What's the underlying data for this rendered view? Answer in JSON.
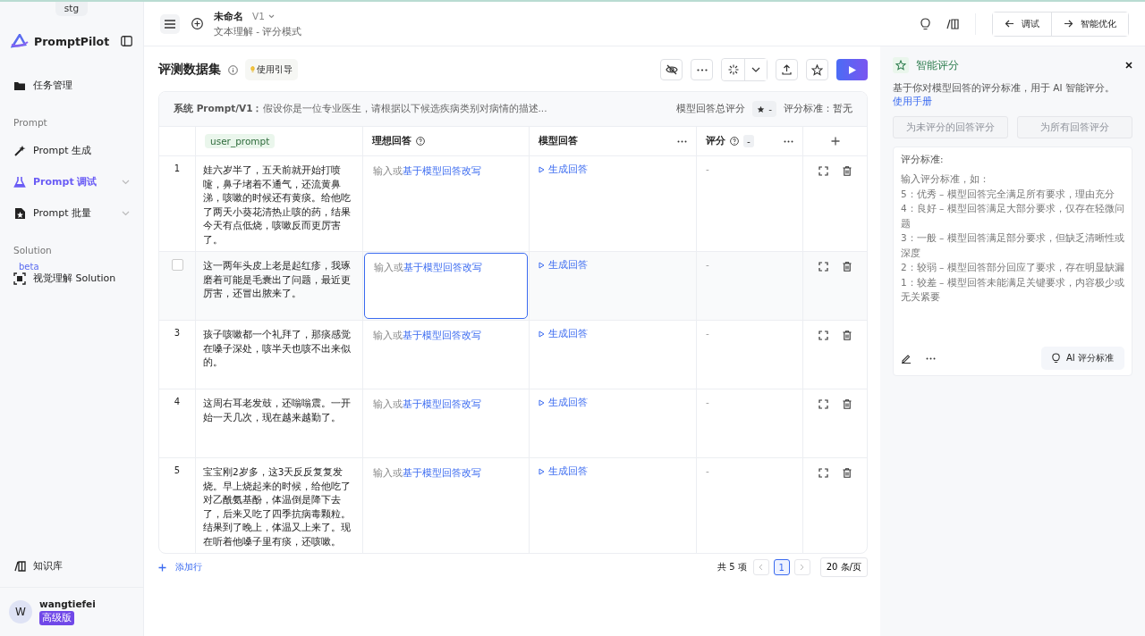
{
  "sidebar": {
    "env": "stg",
    "brand": "PromptPilot",
    "items": [
      {
        "kind": "item",
        "label": "任务管理",
        "selected": false,
        "expandable": false
      },
      {
        "kind": "section",
        "label": "Prompt"
      },
      {
        "kind": "item",
        "label": "Prompt 生成",
        "selected": false,
        "expandable": false
      },
      {
        "kind": "item",
        "label": "Prompt 调试",
        "selected": true,
        "expandable": true
      },
      {
        "kind": "item",
        "label": "Prompt 批量",
        "selected": false,
        "expandable": true
      },
      {
        "kind": "section",
        "label": "Solution"
      },
      {
        "kind": "item",
        "label": "视觉理解 Solution",
        "badge": "beta",
        "selected": false,
        "expandable": false
      }
    ],
    "bottom_item": "知识库",
    "user": {
      "initial": "W",
      "name": "wangtiefei",
      "plan": "高级版"
    }
  },
  "topbar": {
    "title": "未命名",
    "version": "V1",
    "subtitle": "文本理解 - 评分模式",
    "buttons": [
      {
        "kind": "back",
        "label": "调试"
      },
      {
        "kind": "forward",
        "label": "智能优化"
      }
    ]
  },
  "dataset": {
    "title": "评测数据集",
    "guide": "使用引导",
    "system_label": "系统 Prompt/V1：",
    "system_prompt": "假设你是一位专业医生，请根据以下候选疾病类别对病情的描述...",
    "total_score_label": "模型回答总评分",
    "total_score": "-",
    "criteria_label": "评分标准：",
    "criteria_value": "暂无",
    "columns": [
      {
        "kind": "tag",
        "label": "user_prompt"
      },
      {
        "kind": "help",
        "label": "理想回答"
      },
      {
        "kind": "menu",
        "label": "模型回答"
      },
      {
        "kind": "score",
        "label": "评分",
        "value": "-"
      }
    ],
    "rows": [
      {
        "index": "1",
        "hovered": false,
        "user_prompt": "娃六岁半了，五天前就开始打喷嚏，鼻子堵着不通气，还流黄鼻涕，咳嗽的时候还有黄痰。给他吃了两天小葵花清热止咳的药，结果今天有点低烧，咳嗽反而更厉害了。",
        "ideal_prefix": "输入或",
        "ideal_link": "基于模型回答改写",
        "generate": "生成回答",
        "score": "-"
      },
      {
        "hovered": true,
        "checked": false,
        "user_prompt": "这一两年头皮上老是起红疹，我琢磨着可能是毛囊出了问题，最近更厉害，还冒出脓来了。",
        "ideal_prefix": "输入或",
        "ideal_link": "基于模型回答改写",
        "generate": "生成回答",
        "score": "-"
      },
      {
        "index": "3",
        "hovered": false,
        "user_prompt": "孩子咳嗽都一个礼拜了，那痰感觉在嗓子深处，咳半天也咳不出来似的。",
        "ideal_prefix": "输入或",
        "ideal_link": "基于模型回答改写",
        "generate": "生成回答",
        "score": "-"
      },
      {
        "index": "4",
        "hovered": false,
        "user_prompt": "这周右耳老发鼓，还嗡嗡震。一开始一天几次，现在越来越勤了。",
        "ideal_prefix": "输入或",
        "ideal_link": "基于模型回答改写",
        "generate": "生成回答",
        "score": "-"
      },
      {
        "index": "5",
        "hovered": false,
        "user_prompt": "宝宝刚2岁多，这3天反反复复发烧。早上烧起来的时候，给他吃了对乙酰氨基酚，体温倒是降下去了，后来又吃了四季抗病毒颗粒。结果到了晚上，体温又上来了。现在听着他嗓子里有痰，还咳嗽。",
        "ideal_prefix": "输入或",
        "ideal_link": "基于模型回答改写",
        "generate": "生成回答",
        "score": "-"
      }
    ],
    "add_row": "添加行",
    "pagination": {
      "total": "共 5 项",
      "pages": [
        {
          "label": "1",
          "selected": true
        }
      ],
      "page_size": "20 条/页"
    }
  },
  "panel": {
    "title": "智能评分",
    "description": "基于你对模型回答的评分标准，用于 AI 智能评分。",
    "link": "使用手册",
    "buttons": [
      {
        "label": "为未评分的回答评分",
        "disabled": true
      },
      {
        "label": "为所有回答评分",
        "disabled": true
      }
    ],
    "criteria": {
      "label": "评分标准:",
      "placeholder": "输入评分标准，如：\n5：优秀 – 模型回答完全满足所有要求，理由充分\n4：良好 – 模型回答满足大部分要求，仅存在轻微问题\n3：一般 – 模型回答满足部分要求，但缺乏清晰性或深度\n2：较弱 – 模型回答部分回应了要求，存在明显缺漏\n1：较差 – 模型回答未能满足关键要求，内容极少或无关紧要",
      "ai_button": "AI 评分标准"
    }
  }
}
